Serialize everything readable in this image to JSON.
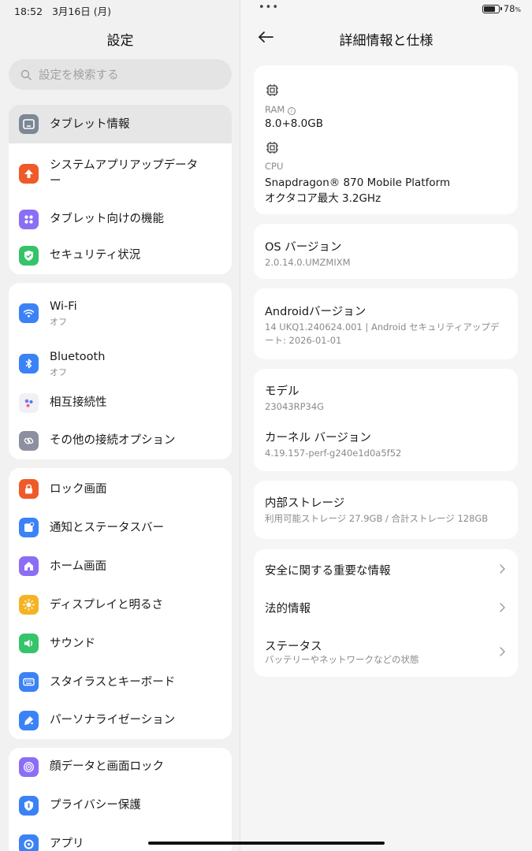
{
  "status": {
    "time": "18:52",
    "date": "3月16日 (月)",
    "dots": "•••",
    "battery_pct": "78",
    "battery_unit": "%",
    "battery_level": 0.78
  },
  "left": {
    "title": "設定",
    "search_placeholder": "設定を検索する",
    "groups": [
      {
        "items": [
          {
            "label": "タブレット情報",
            "icon": "tablet-icon",
            "color": "#7d8796",
            "selected": true
          },
          {
            "label": "システムアプリアップデータ",
            "label2": "ー",
            "icon": "arrow-up-icon",
            "color": "#f05a28"
          },
          {
            "label": "タブレット向けの機能",
            "icon": "grid-icon",
            "color": "#8c6ef5"
          },
          {
            "label": "セキュリティ状況",
            "icon": "shield-check-icon",
            "color": "#35c46a"
          }
        ]
      },
      {
        "items": [
          {
            "label": "Wi-Fi",
            "sub": "オフ",
            "icon": "wifi-icon",
            "color": "#3b82f6"
          },
          {
            "label": "Bluetooth",
            "sub": "オフ",
            "icon": "bluetooth-icon",
            "color": "#3b82f6"
          },
          {
            "label": "相互接続性",
            "icon": "dots-icon",
            "color": "#f0f0f5"
          },
          {
            "label": "その他の接続オプション",
            "icon": "link-icon",
            "color": "#8c8fa0"
          }
        ]
      },
      {
        "items": [
          {
            "label": "ロック画面",
            "icon": "lock-icon",
            "color": "#f05a28"
          },
          {
            "label": "通知とステータスバー",
            "icon": "notification-icon",
            "color": "#3b82f6"
          },
          {
            "label": "ホーム画面",
            "icon": "home-icon",
            "color": "#8c6ef5"
          },
          {
            "label": "ディスプレイと明るさ",
            "icon": "sun-icon",
            "color": "#f5b324"
          },
          {
            "label": "サウンド",
            "icon": "speaker-icon",
            "color": "#35c46a"
          },
          {
            "label": "スタイラスとキーボード",
            "icon": "keyboard-icon",
            "color": "#3b82f6"
          },
          {
            "label": "パーソナライゼーション",
            "icon": "brush-icon",
            "color": "#3b82f6"
          }
        ]
      },
      {
        "items": [
          {
            "label": "顔データと画面ロック",
            "icon": "face-icon",
            "color": "#8c6ef5"
          },
          {
            "label": "プライバシー保護",
            "icon": "privacy-icon",
            "color": "#3b82f6"
          },
          {
            "label": "アプリ",
            "icon": "gear-icon",
            "color": "#3b82f6"
          }
        ]
      }
    ]
  },
  "right": {
    "title": "詳細情報と仕様",
    "ram_label": "RAM",
    "ram_value": "8.0+8.0GB",
    "cpu_label": "CPU",
    "cpu_value": "Snapdragon® 870 Mobile Platform",
    "cpu_value2": "オクタコア最大 3.2GHz",
    "os_label": "OS バージョン",
    "os_value": "2.0.14.0.UMZMIXM",
    "android_label": "Androidバージョン",
    "android_value": "14 UKQ1.240624.001 | Android セキュリティアップデ",
    "android_value2": "ート: 2026-01-01",
    "model_label": "モデル",
    "model_value": "23043RP34G",
    "kernel_label": "カーネル バージョン",
    "kernel_value": "4.19.157-perf-g240e1d0a5f52",
    "storage_label": "内部ストレージ",
    "storage_value": "利用可能ストレージ  27.9GB / 合計ストレージ  128GB",
    "safety_label": "安全に関する重要な情報",
    "legal_label": "法的情報",
    "status_label": "ステータス",
    "status_sub": "バッテリーやネットワークなどの状態"
  }
}
